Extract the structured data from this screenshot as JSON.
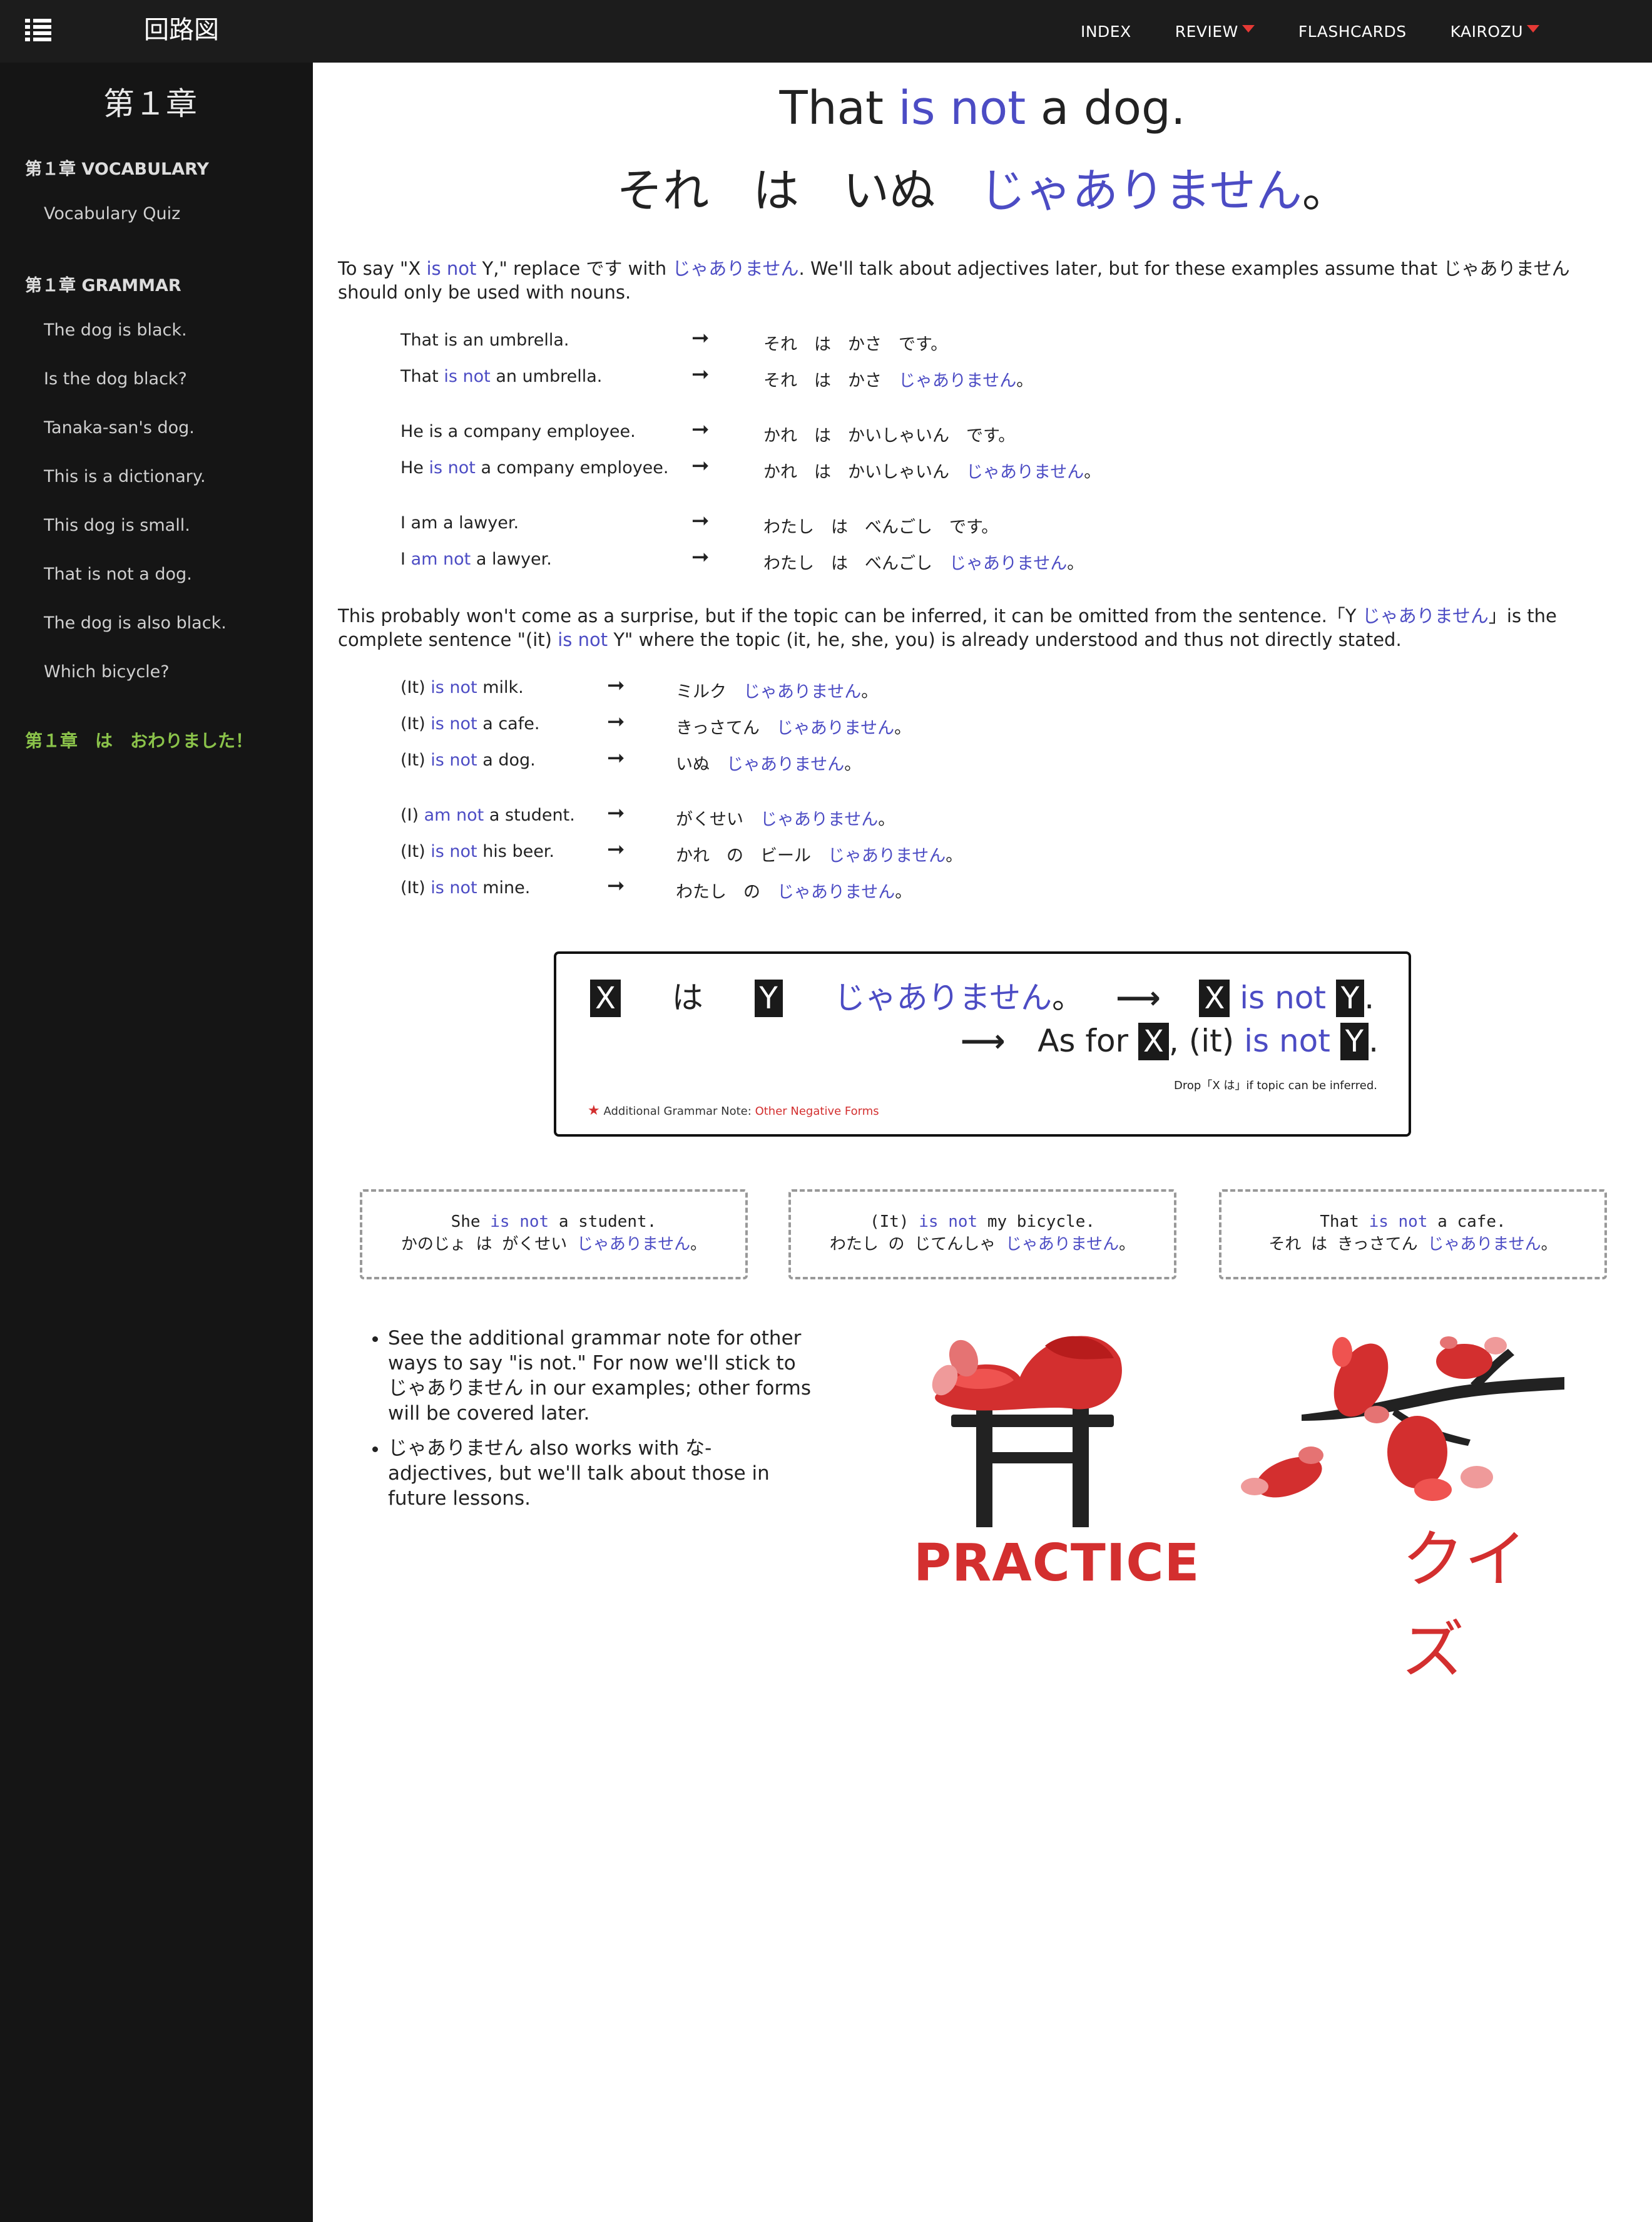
{
  "header": {
    "site_title": "回路図",
    "nav": [
      {
        "label": "INDEX",
        "dropdown": false
      },
      {
        "label": "REVIEW",
        "dropdown": true
      },
      {
        "label": "FLASHCARDS",
        "dropdown": false
      },
      {
        "label": "KAIROZU",
        "dropdown": true
      }
    ]
  },
  "sidebar": {
    "chapter_title": "第１章",
    "vocab_heading": "第１章 VOCABULARY",
    "vocab_items": [
      "Vocabulary Quiz"
    ],
    "grammar_heading": "第１章 GRAMMAR",
    "grammar_items": [
      "The dog is black.",
      "Is the dog black?",
      "Tanaka-san's dog.",
      "This is a dictionary.",
      "This dog is small.",
      "That is not a dog.",
      "The dog is also black.",
      "Which bicycle?"
    ],
    "done_text": "第１章　は　おわりました！"
  },
  "title": {
    "en_pre": "That",
    "en_hl": "is not",
    "en_post": "a dog.",
    "jp_1": "それ",
    "jp_2": "は",
    "jp_3": "いぬ",
    "jp_hl": "じゃありません",
    "jp_end": "。"
  },
  "intro": {
    "t1": "To say \"X",
    "hl1": "is not",
    "t2": "Y,\" replace です with",
    "hl2": "じゃありません",
    "t3": ". We'll talk about adjectives later, but for these examples assume that じゃありません should only be used with nouns."
  },
  "examples1": [
    {
      "en_pre": "That is an umbrella.",
      "en_hl": "",
      "en_post": "",
      "jp": "それ　は　かさ　です。",
      "jp_hl": "",
      "jp_end": ""
    },
    {
      "en_pre": "That",
      "en_hl": "is not",
      "en_post": "an umbrella.",
      "jp": "それ　は　かさ",
      "jp_hl": "じゃありません",
      "jp_end": "。"
    },
    {
      "en_pre": "He is a company employee.",
      "en_hl": "",
      "en_post": "",
      "jp": "かれ　は　かいしゃいん　です。",
      "jp_hl": "",
      "jp_end": ""
    },
    {
      "en_pre": "He",
      "en_hl": "is not",
      "en_post": "a company employee.",
      "jp": "かれ　は　かいしゃいん",
      "jp_hl": "じゃありません",
      "jp_end": "。"
    },
    {
      "en_pre": "I am a lawyer.",
      "en_hl": "",
      "en_post": "",
      "jp": "わたし　は　べんごし　です。",
      "jp_hl": "",
      "jp_end": ""
    },
    {
      "en_pre": "I",
      "en_hl": "am not",
      "en_post": "a lawyer.",
      "jp": "わたし　は　べんごし",
      "jp_hl": "じゃありません",
      "jp_end": "。"
    }
  ],
  "arrow": "➞",
  "para2": {
    "t1": "This probably won't come as a surprise, but if the topic can be inferred, it can be omitted from the sentence.「Y",
    "hl1": "じゃありません",
    "t2": "」is the complete sentence \"(it)",
    "hl2": "is not",
    "t3": "Y\" where the topic (it, he, she, you) is already understood and thus not directly stated."
  },
  "examples2": [
    {
      "en_pre": "(It)",
      "en_hl": "is not",
      "en_post": "milk.",
      "jp": "ミルク",
      "jp_hl": "じゃありません",
      "jp_end": "。"
    },
    {
      "en_pre": "(It)",
      "en_hl": "is not",
      "en_post": "a cafe.",
      "jp": "きっさてん",
      "jp_hl": "じゃありません",
      "jp_end": "。"
    },
    {
      "en_pre": "(It)",
      "en_hl": "is not",
      "en_post": "a dog.",
      "jp": "いぬ",
      "jp_hl": "じゃありません",
      "jp_end": "。"
    },
    {
      "en_pre": "(I)",
      "en_hl": "am not",
      "en_post": "a student.",
      "jp": "がくせい",
      "jp_hl": "じゃありません",
      "jp_end": "。"
    },
    {
      "en_pre": "(It)",
      "en_hl": "is not",
      "en_post": "his beer.",
      "jp": "かれ　の　ビール",
      "jp_hl": "じゃありません",
      "jp_end": "。"
    },
    {
      "en_pre": "(It)",
      "en_hl": "is not",
      "en_post": "mine.",
      "jp": "わたし　の",
      "jp_hl": "じゃありません",
      "jp_end": "。"
    }
  ],
  "grammar_box": {
    "x": "X",
    "wa": "は",
    "y": "Y",
    "neg": "じゃありません",
    "maru": "。",
    "arrow": "⟶",
    "is_not": "is not",
    "period": ".",
    "as_for": "As for",
    "comma_it": ", (it)",
    "drop_note": "Drop「X は」if topic can be inferred.",
    "note_label": "Additional Grammar Note:",
    "note_link": "Other Negative Forms"
  },
  "example_boxes": [
    {
      "en_pre": "She",
      "en_hl": "is not",
      "en_post": "a student.",
      "jp": "かのじょ は がくせい",
      "jp_hl": "じゃありません",
      "jp_end": "。"
    },
    {
      "en_pre": "(It)",
      "en_hl": "is not",
      "en_post": "my bicycle.",
      "jp": "わたし の じてんしゃ",
      "jp_hl": "じゃありません",
      "jp_end": "。"
    },
    {
      "en_pre": "That",
      "en_hl": "is not",
      "en_post": "a cafe.",
      "jp": "それ は きっさてん",
      "jp_hl": "じゃありません",
      "jp_end": "。"
    }
  ],
  "notes": [
    "See the additional grammar note for other ways to say \"is not.\" For now we'll stick to じゃありません in our examples; other forms will be covered later.",
    "じゃありません also works with な-adjectives, but we'll talk about those in future lessons."
  ],
  "practice": {
    "label": "PRACTICE",
    "icon": "torii-gate-icon"
  },
  "quiz": {
    "label": "クイズ",
    "icon": "koi-branch-icon"
  },
  "colors": {
    "accent": "#4c4cc4",
    "red": "#d32f2f",
    "header_bg": "#1c1c1c",
    "sidebar_bg": "#151515",
    "done_green": "#8bc34a"
  }
}
